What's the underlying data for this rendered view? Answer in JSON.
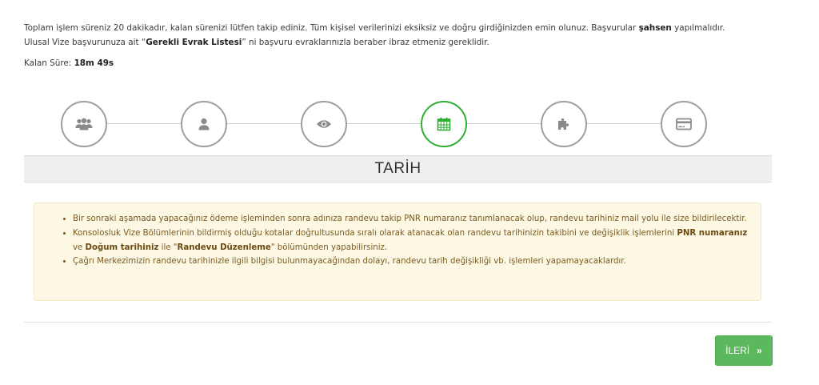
{
  "intro": {
    "line1_pre": "Toplam işlem süreniz 20 dakikadır, kalan sürenizi lütfen takip ediniz. Tüm kişisel verilerinizi eksiksiz ve doğru girdiğinizden emin olunuz. Başvurular ",
    "line1_bold": "şahsen",
    "line1_post": " yapılmalıdır.",
    "line2_pre": "Ulusal Vize başvurunuza ait “",
    "line2_bold": "Gerekli Evrak Listesi",
    "line2_post": "” ni başvuru evraklarınızla beraber ibraz etmeniz gereklidir."
  },
  "timer": {
    "label": "Kalan Süre: ",
    "value": "18m 49s"
  },
  "steps": [
    {
      "icon": "group-icon",
      "active": false
    },
    {
      "icon": "user-icon",
      "active": false
    },
    {
      "icon": "eye-icon",
      "active": false
    },
    {
      "icon": "calendar-icon",
      "active": true
    },
    {
      "icon": "puzzle-icon",
      "active": false
    },
    {
      "icon": "credit-card-icon",
      "active": false
    }
  ],
  "section": {
    "title": "TARİH"
  },
  "notice": {
    "item1": "Bir sonraki aşamada yapacağınız ödeme işleminden sonra adınıza randevu takip PNR numaranız tanımlanacak olup, randevu tarihiniz mail yolu ile size bildirilecektir.",
    "item2_a": "Konsolosluk Vize Bölümlerinin bildirmiş olduğu kotalar doğrultusunda sıralı olarak atanacak olan randevu tarihinizin takibini ve değişiklik işlemlerini ",
    "item2_b1": "PNR numaranız",
    "item2_c": " ve ",
    "item2_b2": "Doğum tarihiniz",
    "item2_d": " ile \"",
    "item2_b3": "Randevu Düzenleme",
    "item2_e": "\" bölümünden yapabilirsiniz.",
    "item3": "Çağrı Merkezimizin randevu tarihinizle ilgili bilgisi bulunmayacağından dolayı, randevu tarih değişikliği vb. işlemleri yapamayacaklardır."
  },
  "buttons": {
    "next_label": "İLERİ",
    "next_chevron": "»"
  },
  "colors": {
    "accent": "#2eae32",
    "button": "#5cb85c",
    "notice_bg": "#fcf8e3",
    "notice_text": "#7a5a22"
  }
}
